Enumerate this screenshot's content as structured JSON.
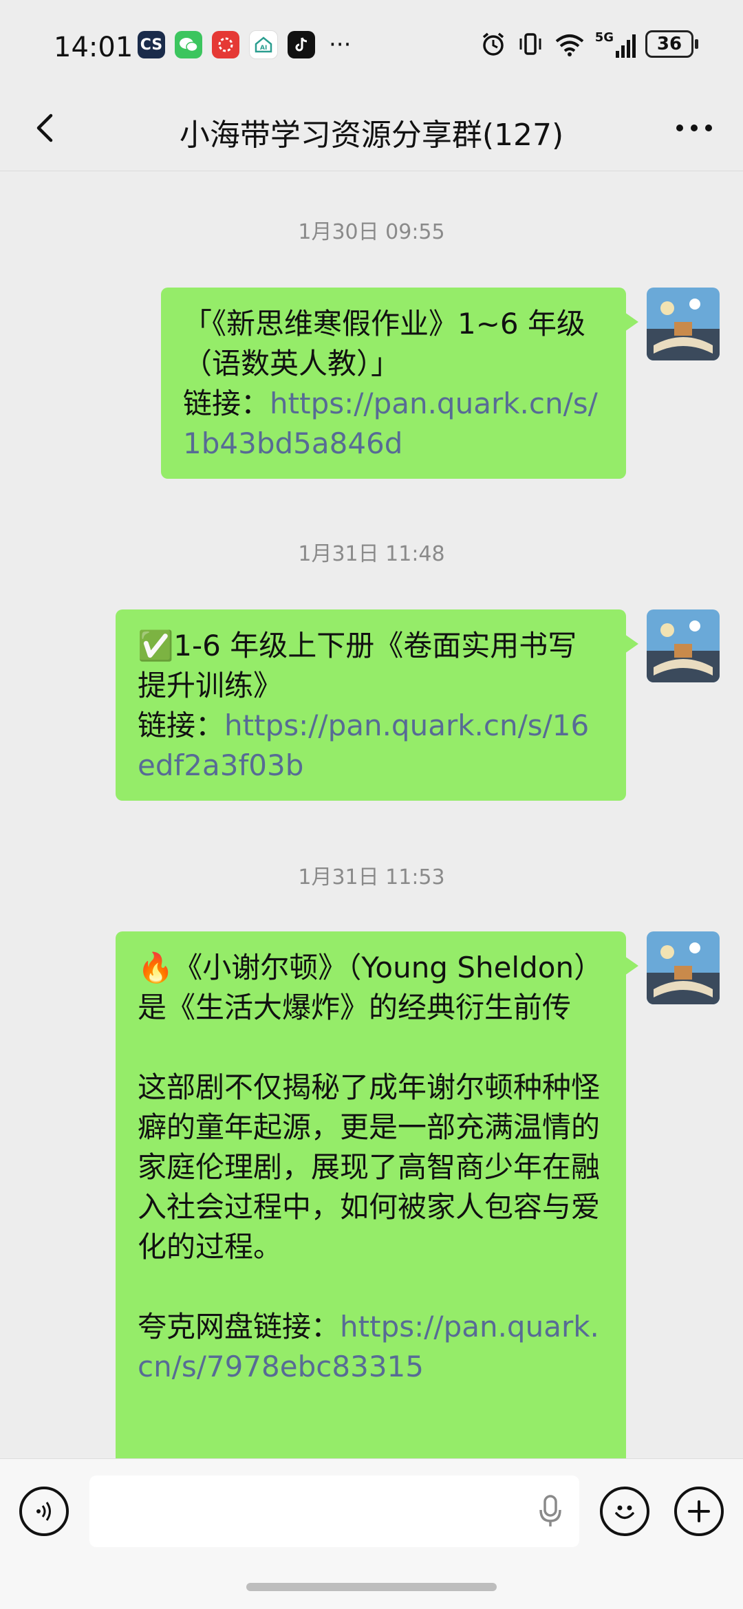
{
  "status_bar": {
    "time": "14:01",
    "app_icons": [
      "CS",
      "wechat-icon",
      "app-red-icon",
      "ai-icon",
      "tiktok-icon"
    ],
    "more": "···",
    "network": "5G",
    "battery": "36"
  },
  "nav": {
    "title": "小海带学习资源分享群(127)"
  },
  "messages": [
    {
      "timestamp": "1月30日 09:55",
      "text": "「《新思维寒假作业》1~6 年级（语数英人教）」",
      "link_label": "链接：",
      "link": "https://pan.quark.cn/s/1b43bd5a846d"
    },
    {
      "timestamp": "1月31日 11:48",
      "text": "✅1-6 年级上下册《卷面实用书写提升训练》",
      "link_label": "链接：",
      "link": "https://pan.quark.cn/s/16edf2a3f03b"
    },
    {
      "timestamp": "1月31日 11:53",
      "text": "🔥《小谢尔顿》（Young Sheldon）是《生活大爆炸》的经典衍生前传",
      "paragraph": "这部剧不仅揭秘了成年谢尔顿种种怪癖的童年起源，更是一部充满温情的家庭伦理剧，展现了高智商少年在融入社会过程中，如何被家人包容与爱化的过程。",
      "link_label": "夸克网盘链接：",
      "link": "https://pan.quark.cn/s/7978ebc83315"
    }
  ],
  "input_bar": {
    "placeholder": ""
  },
  "colors": {
    "bubble": "#95ec69",
    "link": "#576b95",
    "background": "#ededed"
  }
}
